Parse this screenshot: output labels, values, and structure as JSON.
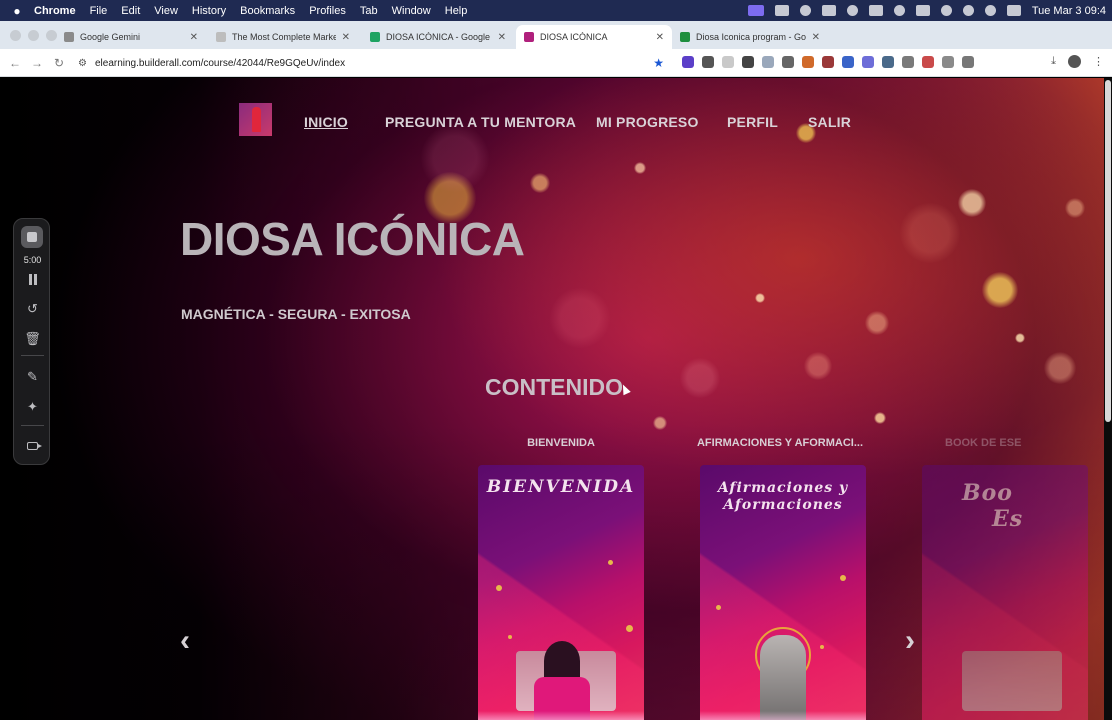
{
  "menubar": {
    "app": "Chrome",
    "items": [
      "File",
      "Edit",
      "View",
      "History",
      "Bookmarks",
      "Profiles",
      "Tab",
      "Window",
      "Help"
    ],
    "clock": "Tue Mar 3  09:4"
  },
  "tabs": [
    {
      "label": "Google Gemini",
      "favicon_color": "#8a8a8a"
    },
    {
      "label": "The Most Complete Marketin",
      "favicon_color": "#bdbdbd"
    },
    {
      "label": "DIOSA ICÓNICA - Google Dri",
      "favicon_color": "#1ea362"
    },
    {
      "label": "DIOSA ICÓNICA",
      "favicon_color": "#b0207c",
      "active": true
    },
    {
      "label": "Diosa Iconica program - Goo",
      "favicon_color": "#1e8e3e"
    }
  ],
  "address": {
    "url": "elearning.builderall.com/course/42044/Re9GQeUv/index"
  },
  "extensions_colors": [
    "#5b3fc8",
    "#555555",
    "#c9c9c9",
    "#444444",
    "#9aa8bb",
    "#666666",
    "#d06a2a",
    "#9a3838",
    "#3a64c8",
    "#6d6dd8",
    "#4a6a8a",
    "#7a7a7a",
    "#c94a4a",
    "#8a8a8a",
    "#777777"
  ],
  "site": {
    "nav": [
      {
        "label": "INICIO",
        "active": true
      },
      {
        "label": "PREGUNTA A TU MENTORA"
      },
      {
        "label": "MI PROGRESO"
      },
      {
        "label": "PERFIL"
      },
      {
        "label": "SALIR"
      }
    ],
    "hero_title": "DIOSA ICÓNICA",
    "hero_subtitle": "MAGNÉTICA - SEGURA - EXITOSA",
    "section_title": "CONTENIDO",
    "courses": [
      {
        "label": "BIENVENIDA",
        "cover_title": "BIENVENIDA"
      },
      {
        "label": "AFIRMACIONES Y AFORMACI...",
        "cover_title_line1": "Afirmaciones y",
        "cover_title_line2": "Aformaciones"
      },
      {
        "label": "BOOK DE ESE",
        "cover_title_line1": "Boo",
        "cover_title_line2": "Es"
      }
    ],
    "prev_arrow": "‹",
    "next_arrow": "›"
  },
  "recorder": {
    "timer": "5:00"
  }
}
